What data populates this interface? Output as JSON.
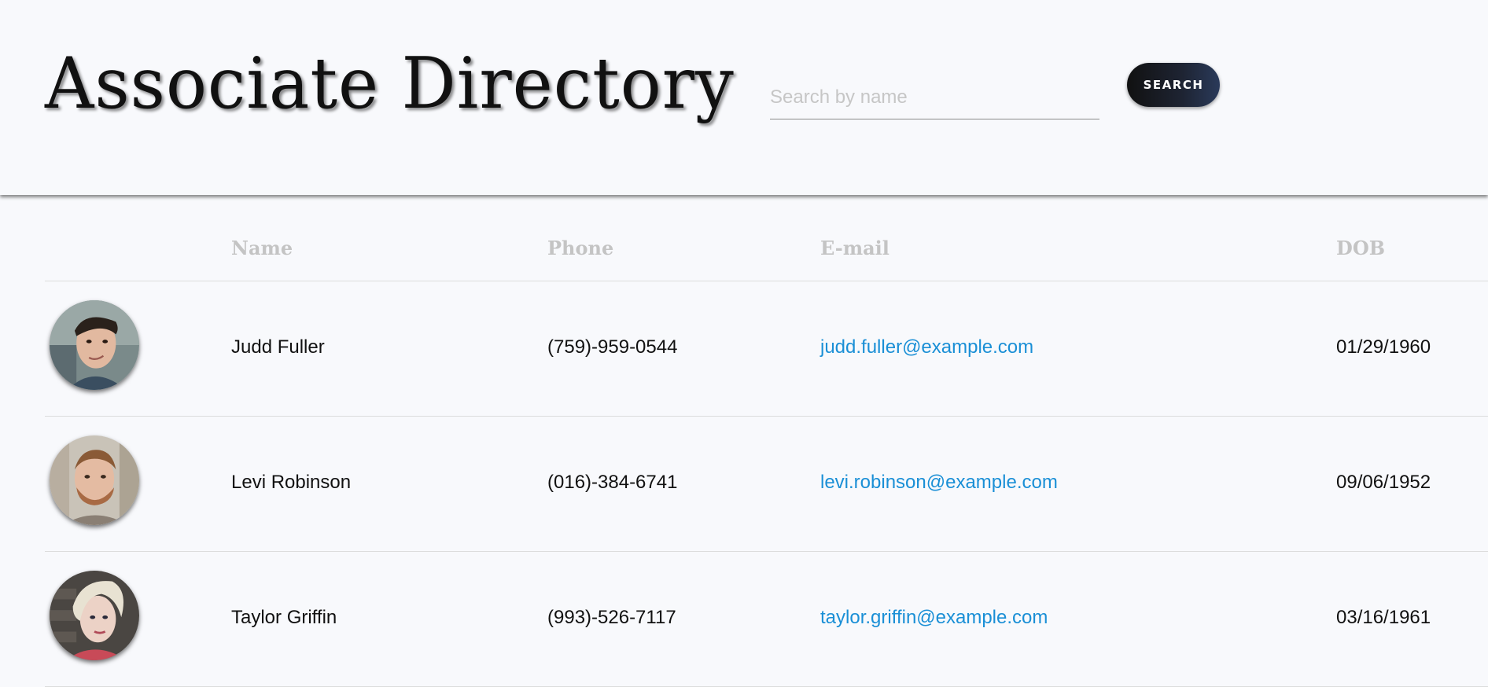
{
  "header": {
    "title": "Associate Directory",
    "search_placeholder": "Search by name",
    "search_value": "",
    "search_button_label": "SEARCH"
  },
  "table": {
    "columns": [
      "",
      "Name",
      "Phone",
      "E-mail",
      "DOB"
    ],
    "rows": [
      {
        "name": "Judd Fuller",
        "phone": "(759)-959-0544",
        "email": "judd.fuller@example.com",
        "dob": "01/29/1960",
        "avatar": "avatar-photo"
      },
      {
        "name": "Levi Robinson",
        "phone": "(016)-384-6741",
        "email": "levi.robinson@example.com",
        "dob": "09/06/1952",
        "avatar": "avatar-photo"
      },
      {
        "name": "Taylor Griffin",
        "phone": "(993)-526-7117",
        "email": "taylor.griffin@example.com",
        "dob": "03/16/1961",
        "avatar": "avatar-photo"
      }
    ]
  },
  "colors": {
    "background": "#f8f9fc",
    "link": "#1a8fd6",
    "header_label": "#c4c4c4",
    "button_start": "#111111",
    "button_end": "#2a3a5a"
  }
}
